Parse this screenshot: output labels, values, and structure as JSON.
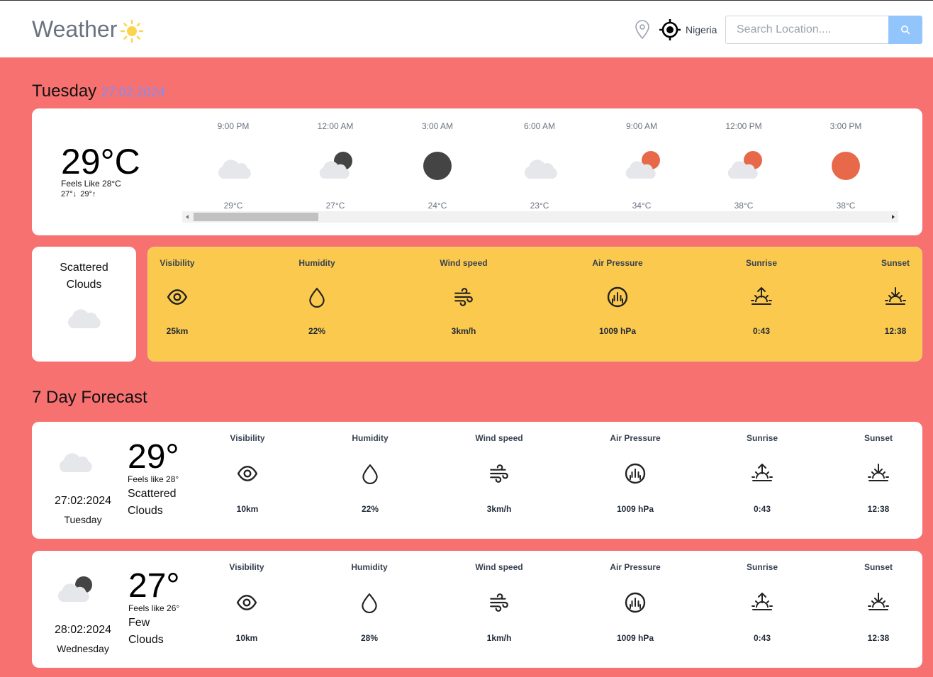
{
  "header": {
    "brand": "Weather",
    "country": "Nigeria",
    "search_placeholder": "Search Location...."
  },
  "today": {
    "day": "Tuesday",
    "date": "27:02:2024",
    "temp": "29°C",
    "feels_like": "Feels Like 28°C",
    "min": "27°",
    "max": "29°",
    "description_line1": "Scattered",
    "description_line2": "Clouds",
    "hourly": [
      {
        "time": "9:00 PM",
        "temp": "29°C",
        "icon": "cloud-icon"
      },
      {
        "time": "12:00 AM",
        "temp": "27°C",
        "icon": "cloud-moon-icon"
      },
      {
        "time": "3:00 AM",
        "temp": "24°C",
        "icon": "moon-icon"
      },
      {
        "time": "6:00 AM",
        "temp": "23°C",
        "icon": "cloud-icon"
      },
      {
        "time": "9:00 AM",
        "temp": "34°C",
        "icon": "cloud-sun-icon"
      },
      {
        "time": "12:00 PM",
        "temp": "38°C",
        "icon": "cloud-sun-icon"
      },
      {
        "time": "3:00 PM",
        "temp": "38°C",
        "icon": "sun-icon"
      }
    ],
    "highlights": {
      "visibility": {
        "label": "Visibility",
        "value": "25km"
      },
      "humidity": {
        "label": "Humidity",
        "value": "22%"
      },
      "wind": {
        "label": "Wind speed",
        "value": "3km/h"
      },
      "pressure": {
        "label": "Air Pressure",
        "value": "1009 hPa"
      },
      "sunrise": {
        "label": "Sunrise",
        "value": "0:43"
      },
      "sunset": {
        "label": "Sunset",
        "value": "12:38"
      }
    }
  },
  "forecast_title": "7 Day Forecast",
  "forecast": [
    {
      "date": "27:02:2024",
      "day": "Tuesday",
      "temp": "29°",
      "feels_like": "Feels like 28°",
      "desc1": "Scattered",
      "desc2": "Clouds",
      "icon": "cloud-icon",
      "visibility": {
        "label": "Visibility",
        "value": "10km"
      },
      "humidity": {
        "label": "Humidity",
        "value": "22%"
      },
      "wind": {
        "label": "Wind speed",
        "value": "3km/h"
      },
      "pressure": {
        "label": "Air Pressure",
        "value": "1009 hPa"
      },
      "sunrise": {
        "label": "Sunrise",
        "value": "0:43"
      },
      "sunset": {
        "label": "Sunset",
        "value": "12:38"
      }
    },
    {
      "date": "28:02:2024",
      "day": "Wednesday",
      "temp": "27°",
      "feels_like": "Feels like 26°",
      "desc1": "Few",
      "desc2": "Clouds",
      "icon": "cloud-moon-icon",
      "visibility": {
        "label": "Visibility",
        "value": "10km"
      },
      "humidity": {
        "label": "Humidity",
        "value": "28%"
      },
      "wind": {
        "label": "Wind speed",
        "value": "1km/h"
      },
      "pressure": {
        "label": "Air Pressure",
        "value": "1009 hPa"
      },
      "sunrise": {
        "label": "Sunrise",
        "value": "0:43"
      },
      "sunset": {
        "label": "Sunset",
        "value": "12:38"
      }
    }
  ],
  "colors": {
    "background": "#f87171",
    "highlight_card": "#fbc94d",
    "date_accent": "#818cf8",
    "search_button": "#93c5fd",
    "sun": "#e8694a",
    "moon": "#444444",
    "cloud": "#e5e7eb"
  }
}
